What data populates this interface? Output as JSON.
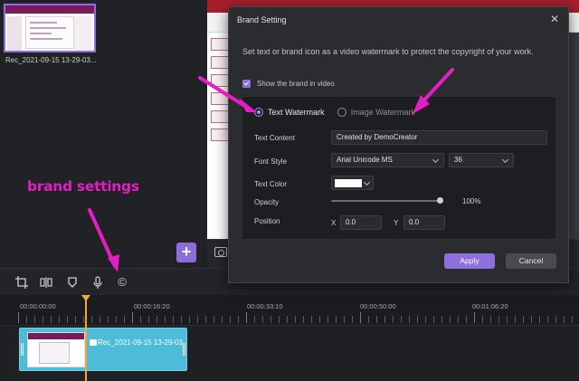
{
  "library": {
    "clip_name": "Rec_2021-09-15 13-29-03..."
  },
  "toolbar": {
    "tools": [
      "crop-icon",
      "split-icon",
      "mask-icon",
      "mic-icon",
      "brand-icon"
    ],
    "brand_symbol": "©"
  },
  "preview": {
    "add_symbol": "+"
  },
  "timeline": {
    "timestamps": [
      "00:00:00:00",
      "00:00:16:20",
      "00:00:33:10",
      "00:00:50:00",
      "00:01:06:20"
    ],
    "clip_name": "Rec_2021-09-15 13-29-03"
  },
  "annotation": {
    "label": "brand settings",
    "color": "#e41ec2"
  },
  "dialog": {
    "title": "Brand Setting",
    "close_symbol": "✕",
    "description": "Set text or brand icon as a video watermark to protect the copyright of your work.",
    "show_brand_label": "Show the brand in video",
    "show_brand_checked": true,
    "watermark_options": [
      "Text Watermark",
      "Image Watermark"
    ],
    "selected_option": "Text Watermark",
    "text_content_label": "Text Content",
    "text_content_value": "Created by DemoCreator",
    "font_style_label": "Font Style",
    "font_value": "Arial Unicode MS",
    "font_size_value": "36",
    "text_color_label": "Text Color",
    "text_color_value": "#ffffff",
    "opacity_label": "Opacity",
    "opacity_value": "100%",
    "opacity_fraction": 1.0,
    "position_label": "Position",
    "x_label": "X",
    "x_value": "0.0",
    "y_label": "Y",
    "y_value": "0.0",
    "apply_label": "Apply",
    "cancel_label": "Cancel",
    "accent_color": "#8e6fe0"
  }
}
